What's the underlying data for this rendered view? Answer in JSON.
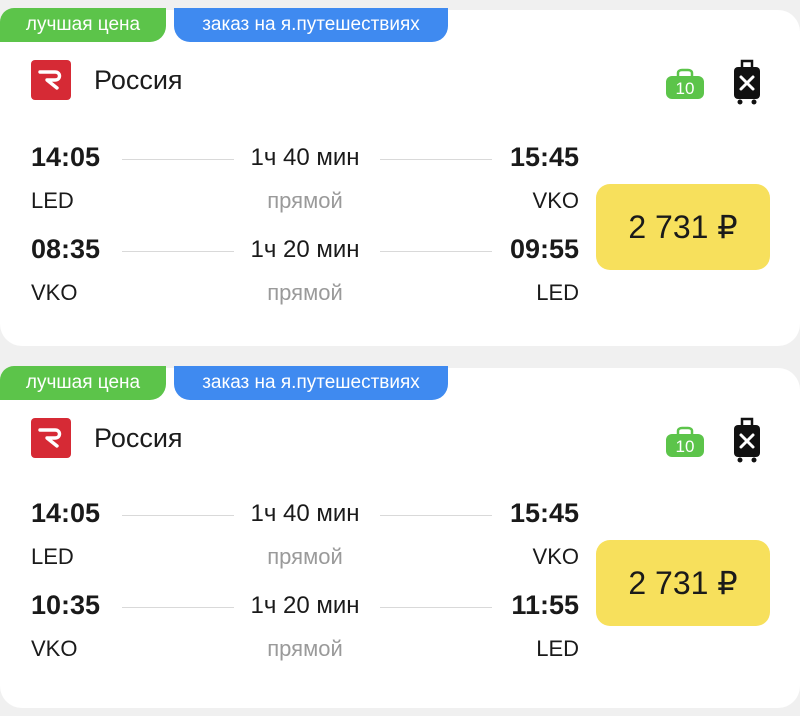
{
  "colors": {
    "best_badge": "#5cc44a",
    "order_badge": "#3f8af0",
    "price_bg": "#f7e05c",
    "airline_logo": "#d62a35",
    "baggage_green": "#5cc44a"
  },
  "cards": [
    {
      "badge_best": "лучшая цена",
      "badge_order": "заказ на я.путешествиях",
      "airline": "Россия",
      "baggage_label": "10",
      "price": "2 731 ₽",
      "segments": [
        {
          "dep_time": "14:05",
          "arr_time": "15:45",
          "duration": "1ч 40 мин",
          "dep_code": "LED",
          "arr_code": "VKO",
          "stops": "прямой"
        },
        {
          "dep_time": "08:35",
          "arr_time": "09:55",
          "duration": "1ч 20 мин",
          "dep_code": "VKO",
          "arr_code": "LED",
          "stops": "прямой"
        }
      ]
    },
    {
      "badge_best": "лучшая цена",
      "badge_order": "заказ на я.путешествиях",
      "airline": "Россия",
      "baggage_label": "10",
      "price": "2 731 ₽",
      "segments": [
        {
          "dep_time": "14:05",
          "arr_time": "15:45",
          "duration": "1ч 40 мин",
          "dep_code": "LED",
          "arr_code": "VKO",
          "stops": "прямой"
        },
        {
          "dep_time": "10:35",
          "arr_time": "11:55",
          "duration": "1ч 20 мин",
          "dep_code": "VKO",
          "arr_code": "LED",
          "stops": "прямой"
        }
      ]
    }
  ]
}
